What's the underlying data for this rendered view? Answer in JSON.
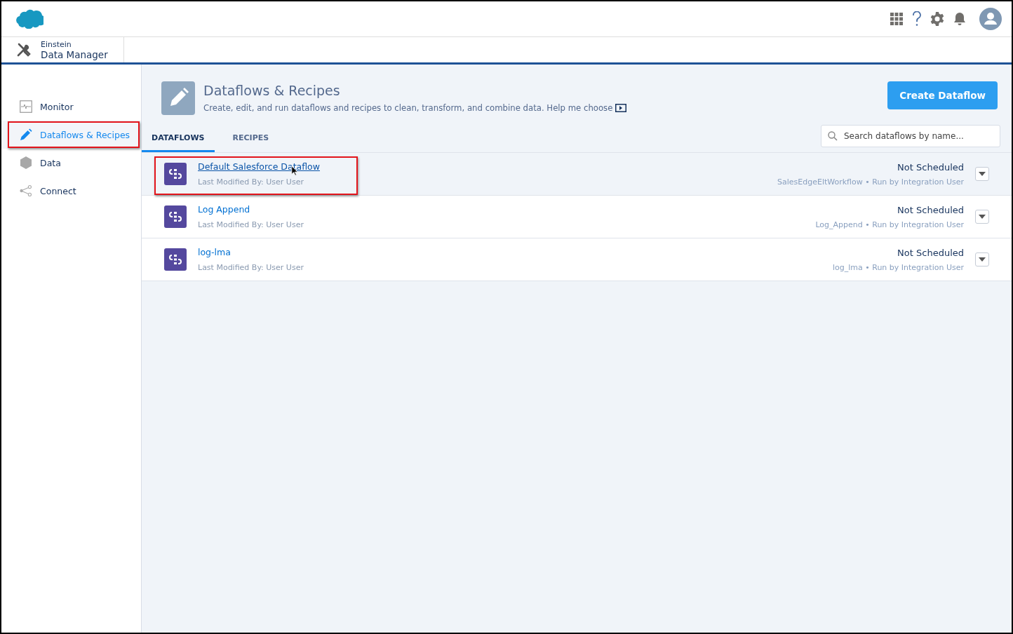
{
  "app": {
    "kicker": "Einstein",
    "title": "Data Manager"
  },
  "sidebar": {
    "items": [
      {
        "label": "Monitor",
        "kind": "monitor",
        "selected": false,
        "highlighted": false
      },
      {
        "label": "Dataflows & Recipes",
        "kind": "pencil",
        "selected": true,
        "highlighted": true
      },
      {
        "label": "Data",
        "kind": "hexagon",
        "selected": false,
        "highlighted": false
      },
      {
        "label": "Connect",
        "kind": "share",
        "selected": false,
        "highlighted": false
      }
    ]
  },
  "page_header": {
    "title": "Dataflows & Recipes",
    "description": "Create, edit, and run dataflows and recipes to clean, transform, and combine data. Help me choose",
    "action": "Create Dataflow"
  },
  "tabs": [
    {
      "label": "DATAFLOWS",
      "selected": true
    },
    {
      "label": "RECIPES",
      "selected": false
    }
  ],
  "search": {
    "placeholder": "Search dataflows by name..."
  },
  "dataflows": [
    {
      "name": "Default Salesforce Dataflow",
      "modified": "Last Modified By: User User",
      "schedule": "Not Scheduled",
      "detail": "SalesEdgeEltWorkflow • Run by Integration User",
      "hovered": true,
      "highlighted": true
    },
    {
      "name": "Log Append",
      "modified": "Last Modified By: User User",
      "schedule": "Not Scheduled",
      "detail": "Log_Append • Run by Integration User",
      "hovered": false,
      "highlighted": false
    },
    {
      "name": "log-lma",
      "modified": "Last Modified By: User User",
      "schedule": "Not Scheduled",
      "detail": "log_lma • Run by Integration User",
      "hovered": false,
      "highlighted": false
    }
  ]
}
